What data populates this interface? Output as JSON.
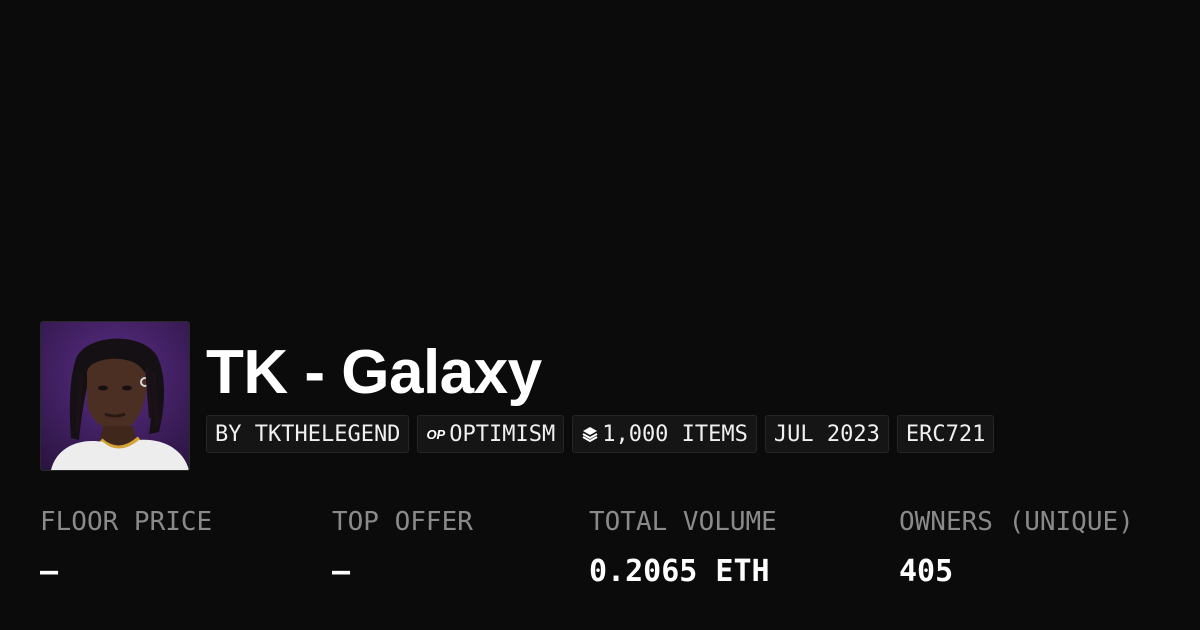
{
  "collection": {
    "title": "TK - Galaxy",
    "avatar_icon": "artist-portrait-image"
  },
  "chips": {
    "creator": "BY TKTHELEGEND",
    "chain": "OPTIMISM",
    "chain_icon": "optimism-op-icon",
    "chain_icon_text": "OP",
    "items": "1,000 ITEMS",
    "items_icon": "layers-icon",
    "date": "JUL 2023",
    "standard": "ERC721"
  },
  "stats": {
    "floor_price": {
      "label": "FLOOR PRICE",
      "value": "–"
    },
    "top_offer": {
      "label": "TOP OFFER",
      "value": "–"
    },
    "total_volume": {
      "label": "TOTAL VOLUME",
      "value": "0.2065 ETH"
    },
    "owners": {
      "label": "OWNERS (UNIQUE)",
      "value": "405"
    }
  },
  "colors": {
    "background": "#0b0b0b",
    "chip_background": "#151515",
    "label_gray": "#8a8a8a",
    "text_white": "#ffffff"
  }
}
